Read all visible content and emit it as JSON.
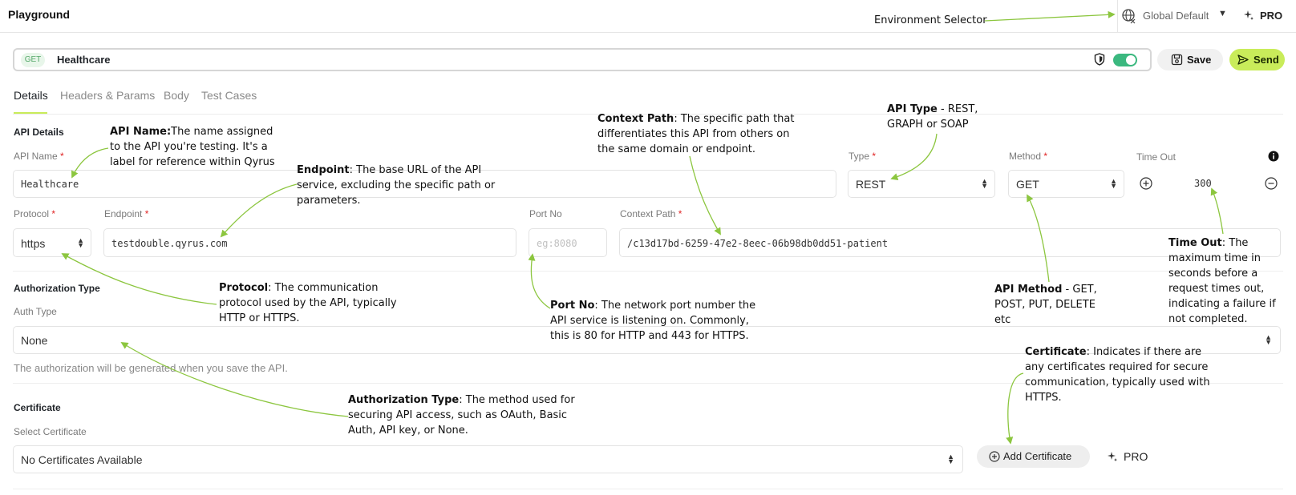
{
  "app": {
    "title": "Playground"
  },
  "environment": {
    "label": "Global Default",
    "pro": "PRO"
  },
  "request": {
    "method": "GET",
    "name": "Healthcare",
    "save_label": "Save",
    "send_label": "Send"
  },
  "tabs": [
    {
      "label": "Details",
      "active": true
    },
    {
      "label": "Headers & Params"
    },
    {
      "label": "Body"
    },
    {
      "label": "Test Cases"
    }
  ],
  "api_details": {
    "heading": "API Details",
    "api_name_label": "API Name",
    "api_name_value": "Healthcare",
    "type_label": "Type",
    "type_value": "REST",
    "method_label": "Method",
    "method_value": "GET",
    "timeout_label": "Time Out",
    "timeout_value": "300",
    "protocol_label": "Protocol",
    "protocol_value": "https",
    "endpoint_label": "Endpoint",
    "endpoint_value": "testdouble.qyrus.com",
    "port_label": "Port No",
    "port_placeholder": "eg:8080",
    "context_label": "Context Path",
    "context_value": "/c13d17bd-6259-47e2-8eec-06b98db0dd51-patient",
    "required_mark": "*"
  },
  "authorization": {
    "heading": "Authorization Type",
    "auth_label": "Auth Type",
    "auth_value": "None",
    "helper": "The authorization will be generated when you save the API."
  },
  "certificate": {
    "heading": "Certificate",
    "select_label": "Select Certificate",
    "select_value": "No Certificates Available",
    "add_label": "Add Certificate",
    "pro": "PRO"
  },
  "annotations": {
    "environment": "Environment Selector",
    "api_name": {
      "term": "API Name:",
      "text": "The name assigned to the API you're testing. It's a label for reference within Qyrus"
    },
    "endpoint": {
      "term": "Endpoint",
      "text": ": The base URL of the API service, excluding the specific path or parameters."
    },
    "context_path": {
      "term": "Context Path",
      "text": ": The specific path that differentiates this API from others on the same domain or endpoint."
    },
    "api_type": {
      "term": "API Type",
      "text": " - REST, GRAPH or SOAP"
    },
    "protocol": {
      "term": "Protocol",
      "text": ": The communication protocol used by the API, typically HTTP or HTTPS."
    },
    "port_no": {
      "term": "Port No",
      "text": ": The network port number the API service is listening on. Commonly, this is 80 for HTTP and 443 for HTTPS."
    },
    "api_method": {
      "term": "API Method",
      "text": " - GET, POST, PUT, DELETE etc"
    },
    "time_out": {
      "term": "Time Out",
      "text": ": The maximum time in seconds before a request times out, indicating a failure if not completed."
    },
    "auth_type": {
      "term": "Authorization Type",
      "text": ": The method used for securing API access, such as OAuth, Basic Auth, API key, or None."
    },
    "certificate": {
      "term": "Certificate",
      "text": ": Indicates if there are any certificates required for secure communication, typically used with HTTPS."
    }
  },
  "colors": {
    "accent": "#c9ec5a",
    "arrow": "#8cc63f",
    "toggle": "#3bb87f",
    "required": "#e02424"
  }
}
